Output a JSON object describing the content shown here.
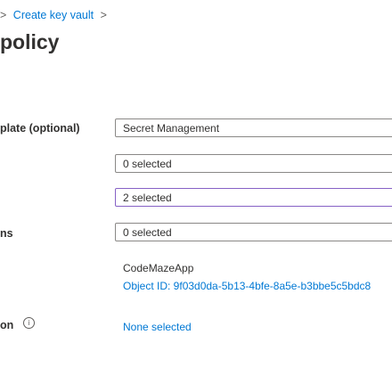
{
  "breadcrumb": {
    "sep1": ">",
    "link": "Create key vault",
    "sep2": ">"
  },
  "title": "policy",
  "fields": {
    "template": {
      "label": "plate (optional)",
      "value": "Secret Management"
    },
    "key_permissions": {
      "value": "0 selected"
    },
    "secret_permissions": {
      "value": "2 selected"
    },
    "cert_permissions": {
      "label": "ns",
      "value": "0 selected"
    }
  },
  "principal": {
    "name": "CodeMazeApp",
    "object_id": "Object ID: 9f03d0da-5b13-4bfe-8a5e-b3bbe5c5bdc8"
  },
  "authorized_application": {
    "label": "on",
    "icon": "info-icon",
    "icon_glyph": "i",
    "value": "None selected"
  }
}
